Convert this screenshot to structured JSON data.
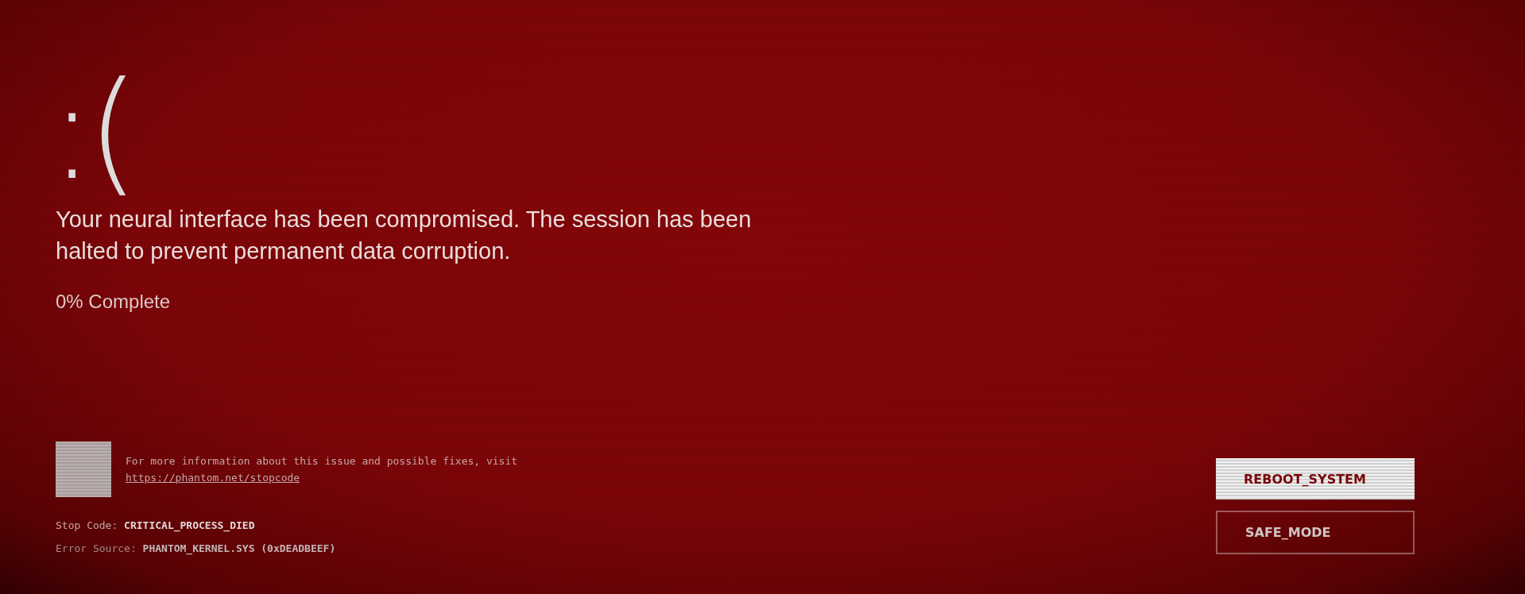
{
  "emoticon": ":(",
  "message": "Your neural interface has been compromised. The session has been halted to prevent permanent data corruption.",
  "progress": "0% Complete",
  "info": {
    "text": "For more information about this issue and possible fixes, visit",
    "link": "https://phantom.net/stopcode"
  },
  "details": [
    {
      "kind": "stop_code",
      "text": "Stop Code: **CRITICAL_PROCESS_DIED**"
    },
    {
      "kind": "error_source",
      "text": "Error Source: **PHANTOM_KERNEL.SYS (0xDEADBEEF)**"
    }
  ],
  "buttons": [
    {
      "label": "REBOOT_SYSTEM",
      "kind": "primary"
    },
    {
      "label": "SAFE_MODE",
      "kind": "outline"
    }
  ]
}
